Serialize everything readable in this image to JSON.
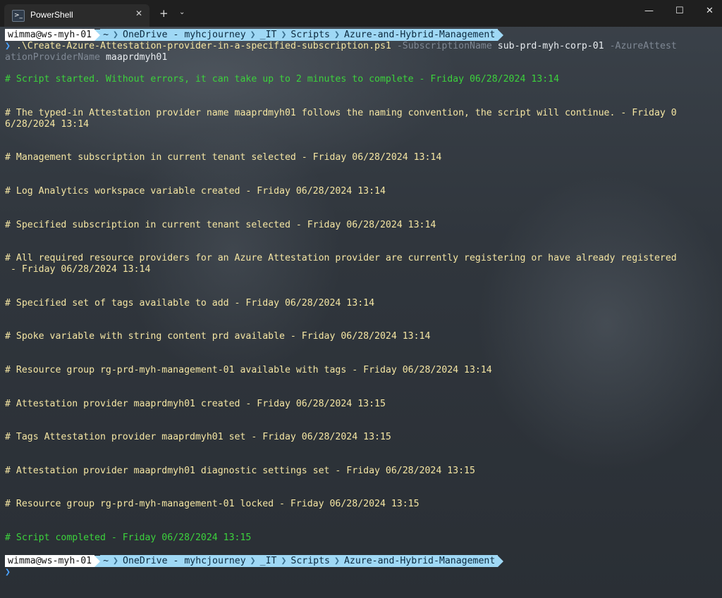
{
  "window": {
    "tab_title": "PowerShell",
    "tab_icon_glyph": ">_",
    "tab_close_glyph": "✕",
    "new_tab_glyph": "+",
    "dropdown_glyph": "⌄",
    "minimize_glyph": "—",
    "maximize_glyph": "☐",
    "close_glyph": "✕"
  },
  "prompt": {
    "user": "wimma@ws-myh-01",
    "segments": [
      "~",
      "OneDrive - myhcjourney",
      "_IT",
      "Scripts",
      "Azure-and-Hybrid-Management"
    ],
    "separator": "❯",
    "input_glyph": "❯"
  },
  "command": {
    "script": ".\\Create-Azure-Attestation-provider-in-a-specified-subscription.ps1",
    "param1_name": "-SubscriptionName",
    "param1_value": "sub-prd-myh-corp-01",
    "param2_name_part1": "-AzureAttest",
    "param2_name_part2": "ationProviderName",
    "param2_value": "maaprdmyh01"
  },
  "output": [
    {
      "text": "# Script started. Without errors, it can take up to 2 minutes to complete - Friday 06/28/2024 13:14",
      "color": "green"
    },
    {
      "text": "# The typed-in Attestation provider name maaprdmyh01 follows the naming convention, the script will continue. - Friday 0",
      "color": "yellow"
    },
    {
      "text": "6/28/2024 13:14",
      "color": "yellow"
    },
    {
      "text": "# Management subscription in current tenant selected - Friday 06/28/2024 13:14",
      "color": "yellow"
    },
    {
      "text": "# Log Analytics workspace variable created - Friday 06/28/2024 13:14",
      "color": "yellow"
    },
    {
      "text": "# Specified subscription in current tenant selected - Friday 06/28/2024 13:14",
      "color": "yellow"
    },
    {
      "text": "# All required resource providers for an Azure Attestation provider are currently registering or have already registered",
      "color": "yellow"
    },
    {
      "text": " - Friday 06/28/2024 13:14",
      "color": "yellow"
    },
    {
      "text": "# Specified set of tags available to add - Friday 06/28/2024 13:14",
      "color": "yellow"
    },
    {
      "text": "# Spoke variable with string content prd available - Friday 06/28/2024 13:14",
      "color": "yellow"
    },
    {
      "text": "# Resource group rg-prd-myh-management-01 available with tags - Friday 06/28/2024 13:14",
      "color": "yellow"
    },
    {
      "text": "# Attestation provider maaprdmyh01 created - Friday 06/28/2024 13:15",
      "color": "yellow"
    },
    {
      "text": "# Tags Attestation provider maaprdmyh01 set - Friday 06/28/2024 13:15",
      "color": "yellow"
    },
    {
      "text": "# Attestation provider maaprdmyh01 diagnostic settings set - Friday 06/28/2024 13:15",
      "color": "yellow"
    },
    {
      "text": "# Resource group rg-prd-myh-management-01 locked - Friday 06/28/2024 13:15",
      "color": "yellow"
    },
    {
      "text": "# Script completed - Friday 06/28/2024 13:15",
      "color": "green"
    }
  ],
  "colors": {
    "yellow": "#f5e6a3",
    "green": "#3cd23c",
    "prompt_path_bg": "#9fd8f5",
    "prompt_user_bg": "#ffffff",
    "param_grey": "#7f8894",
    "prompt_glyph": "#4aa3ff"
  }
}
